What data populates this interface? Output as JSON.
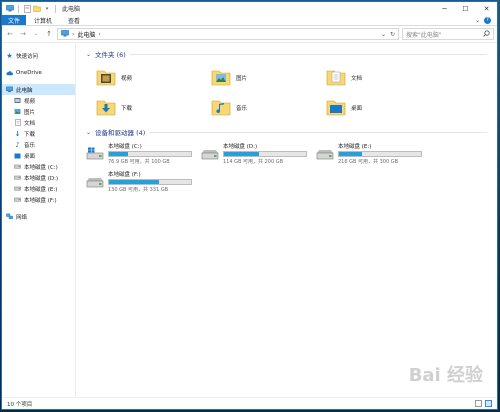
{
  "window": {
    "title": "此电脑"
  },
  "ribbon": {
    "tabs": [
      "文件",
      "计算机",
      "查看"
    ]
  },
  "address": {
    "path": "此电脑",
    "search_placeholder": "搜索\"此电脑\""
  },
  "sidebar": {
    "items": [
      {
        "label": "快速访问",
        "icon": "star-icon"
      },
      {
        "label": "OneDrive",
        "icon": "cloud-icon"
      },
      {
        "label": "此电脑",
        "icon": "computer-icon"
      },
      {
        "label": "视频",
        "icon": "video-folder-icon"
      },
      {
        "label": "图片",
        "icon": "pictures-folder-icon"
      },
      {
        "label": "文档",
        "icon": "documents-folder-icon"
      },
      {
        "label": "下载",
        "icon": "download-icon"
      },
      {
        "label": "音乐",
        "icon": "music-icon"
      },
      {
        "label": "桌面",
        "icon": "desktop-folder-icon"
      },
      {
        "label": "本地磁盘 (C:)",
        "icon": "drive-icon"
      },
      {
        "label": "本地磁盘 (D:)",
        "icon": "drive-icon"
      },
      {
        "label": "本地磁盘 (E:)",
        "icon": "drive-icon"
      },
      {
        "label": "本地磁盘 (F:)",
        "icon": "drive-icon"
      },
      {
        "label": "网络",
        "icon": "network-icon"
      }
    ]
  },
  "folders": {
    "header": "文件夹 (6)",
    "items": [
      {
        "label": "视频",
        "icon": "video-folder-icon"
      },
      {
        "label": "图片",
        "icon": "pictures-folder-icon"
      },
      {
        "label": "文档",
        "icon": "documents-folder-icon"
      },
      {
        "label": "下载",
        "icon": "download-folder-icon"
      },
      {
        "label": "音乐",
        "icon": "music-folder-icon"
      },
      {
        "label": "桌面",
        "icon": "desktop-folder-icon"
      }
    ]
  },
  "drives": {
    "header": "设备和驱动器 (4)",
    "items": [
      {
        "label": "本地磁盘 (C:)",
        "free": "76.9 GB 可用，共 100 GB",
        "used_fraction": 0.23,
        "windows": true
      },
      {
        "label": "本地磁盘 (D:)",
        "free": "114 GB 可用，共 200 GB",
        "used_fraction": 0.43,
        "windows": false
      },
      {
        "label": "本地磁盘 (E:)",
        "free": "216 GB 可用，共 300 GB",
        "used_fraction": 0.28,
        "windows": false
      },
      {
        "label": "本地磁盘 (F:)",
        "free": "130 GB 可用，共 331 GB",
        "used_fraction": 0.61,
        "windows": false
      }
    ]
  },
  "status": {
    "count": "10 个项目"
  },
  "watermark": "Bai 经验",
  "colors": {
    "accent": "#1979ca",
    "bar_fill": "#26a0da",
    "folder": "#f8d775",
    "selected": "#cce8ff"
  }
}
